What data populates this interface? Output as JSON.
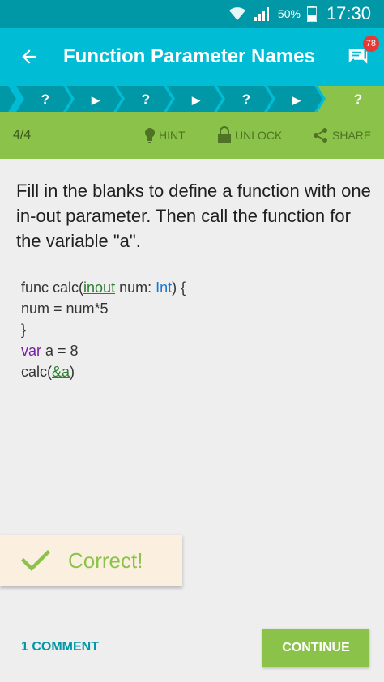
{
  "status_bar": {
    "battery_percent": "50%",
    "time": "17:30",
    "icons": [
      "wifi-icon",
      "signal-icon",
      "battery-icon"
    ]
  },
  "app_bar": {
    "title": "Function Parameter Names",
    "comment_badge": "78",
    "icons": [
      "back-arrow-icon",
      "chat-icon"
    ]
  },
  "progress_strip": {
    "steps": [
      "?",
      "▶",
      "?",
      "▶",
      "?",
      "▶",
      "?"
    ],
    "active_index": 6
  },
  "toolbar": {
    "progress": "4/4",
    "hint_label": "HINT",
    "unlock_label": "UNLOCK",
    "share_label": "SHARE",
    "icons": [
      "lightbulb-icon",
      "lock-icon",
      "share-icon"
    ]
  },
  "question": {
    "text": "Fill in the blanks to define a function with one in-out parameter. Then call the function for the variable \"a\"."
  },
  "code": {
    "l1_a": "func calc(",
    "l1_blank": "inout",
    "l1_b": " num: ",
    "l1_type": "Int",
    "l1_c": ") {",
    "l2": "num = num*5",
    "l3": "}",
    "l4_kw": "var",
    "l4_rest": " a = 8",
    "l5_a": "calc(",
    "l5_blank": "&a",
    "l5_b": ")"
  },
  "result": {
    "text": "Correct!",
    "icon": "checkmark-icon"
  },
  "footer": {
    "comments_label": "1 COMMENT",
    "continue_label": "CONTINUE"
  },
  "colors": {
    "status_bar": "#0097a7",
    "app_bar": "#00bcd4",
    "toolbar": "#8bc34a",
    "accent": "#0097a7",
    "correct": "#8bc34a",
    "badge": "#e53935"
  }
}
